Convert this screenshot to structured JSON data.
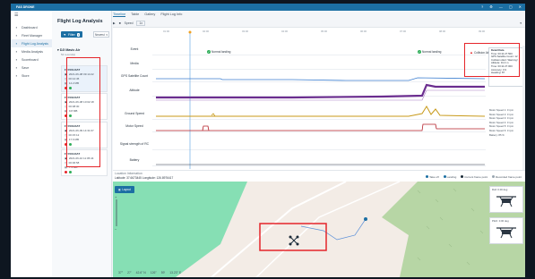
{
  "window": {
    "app_name": "FAS DRONE",
    "controls": [
      "?",
      "⚙",
      "—",
      "▢",
      "✕"
    ]
  },
  "sidebar": {
    "items": [
      {
        "label": "Dashboard",
        "icon": "grid-icon"
      },
      {
        "label": "Fleet Manager",
        "icon": "drone-icon"
      },
      {
        "label": "Flight Log Analysis",
        "icon": "chart-icon",
        "active": true
      },
      {
        "label": "Media Analysis",
        "icon": "image-icon"
      },
      {
        "label": "Scoreboard",
        "icon": "trophy-icon"
      },
      {
        "label": "Save",
        "icon": "save-icon"
      },
      {
        "label": "Store",
        "icon": "plus-icon"
      }
    ]
  },
  "panel": {
    "title": "Flight Log Analysis",
    "filter_label": "Filter",
    "filter_count": "1",
    "sort_label": "Newest",
    "group": {
      "name": "DJI Mavic Air",
      "sub": "54 record(s)"
    },
    "logs": [
      {
        "id": "FLY001.DAT",
        "date": "2021-06-08 09:14:22",
        "duration": "00:12:45",
        "size": "14.2 MB",
        "active": true
      },
      {
        "id": "FLY002.DAT",
        "date": "2021-06-08 10:02:18",
        "duration": "00:08:30",
        "size": "9.8 MB"
      },
      {
        "id": "FLY003.DAT",
        "date": "2021-06-09 14:31:07",
        "duration": "00:15:12",
        "size": "17.6 MB"
      },
      {
        "id": "FLY004.DAT",
        "date": "2021-06-10 11:05:44",
        "duration": "00:06:58",
        "size": "7.1 MB"
      }
    ]
  },
  "tabs": [
    "Timeline",
    "Table",
    "Gallery",
    "Flight Log Info"
  ],
  "controls": {
    "speed_label": "Speed",
    "speed_value": "1x"
  },
  "timeline": {
    "ticks": [
      "01:00",
      "02:00",
      "03:00",
      "04:00",
      "05:00",
      "06:00",
      "07:00",
      "08:00",
      "09:00"
    ],
    "rows": [
      "Event",
      "Media",
      "GPS Satellite Count",
      "Altitude",
      "Ground Speed",
      "Motor Speed",
      "Signal strength of RC",
      "Battery"
    ],
    "events": [
      {
        "label": "Normal landing",
        "type": "ok"
      },
      {
        "label": "Normal landing",
        "type": "ok"
      },
      {
        "label": "Collision Alert",
        "type": "warn"
      }
    ],
    "tooltip": [
      "Detail Data",
      "Time: 00:11:27.500",
      "GPS Satellite Count: 12",
      "Collision Alert: Warning!",
      "Altitude: 91.3 m",
      "Time: 00:11:27.000",
      "Accuracy: 0.9",
      "Heading: 87"
    ],
    "side_legend": [
      "Motor Speed 1: 0 rpm",
      "Motor Speed 2: 0 rpm",
      "Motor Speed 3: 0 rpm",
      "Motor Speed 4: 0 rpm",
      "Motor Speed 5: 0 rpm",
      "Motor Speed 6: 0 rpm",
      "Battery: 85 %"
    ]
  },
  "location": {
    "title": "Location Information",
    "coords": "Latitude: 37.6673445  Longitude: 126.8976417",
    "legend": [
      {
        "label": "Take off",
        "color": "#1c6fa3"
      },
      {
        "label": "Landing",
        "color": "#1c6fa3"
      },
      {
        "label": "Current frame point",
        "color": "#1b2a38"
      },
      {
        "label": "Recorded frame point",
        "color": "#9aa5b1"
      }
    ],
    "map_button": "Layout",
    "bottom_readout": [
      "37°",
      "27'",
      "42.6\" N",
      "126°",
      "59'",
      "13.23\" E"
    ]
  },
  "drone_cards": [
    {
      "title": "Roll: 0.00 deg"
    },
    {
      "title": "Pitch: 0.00 deg"
    }
  ]
}
